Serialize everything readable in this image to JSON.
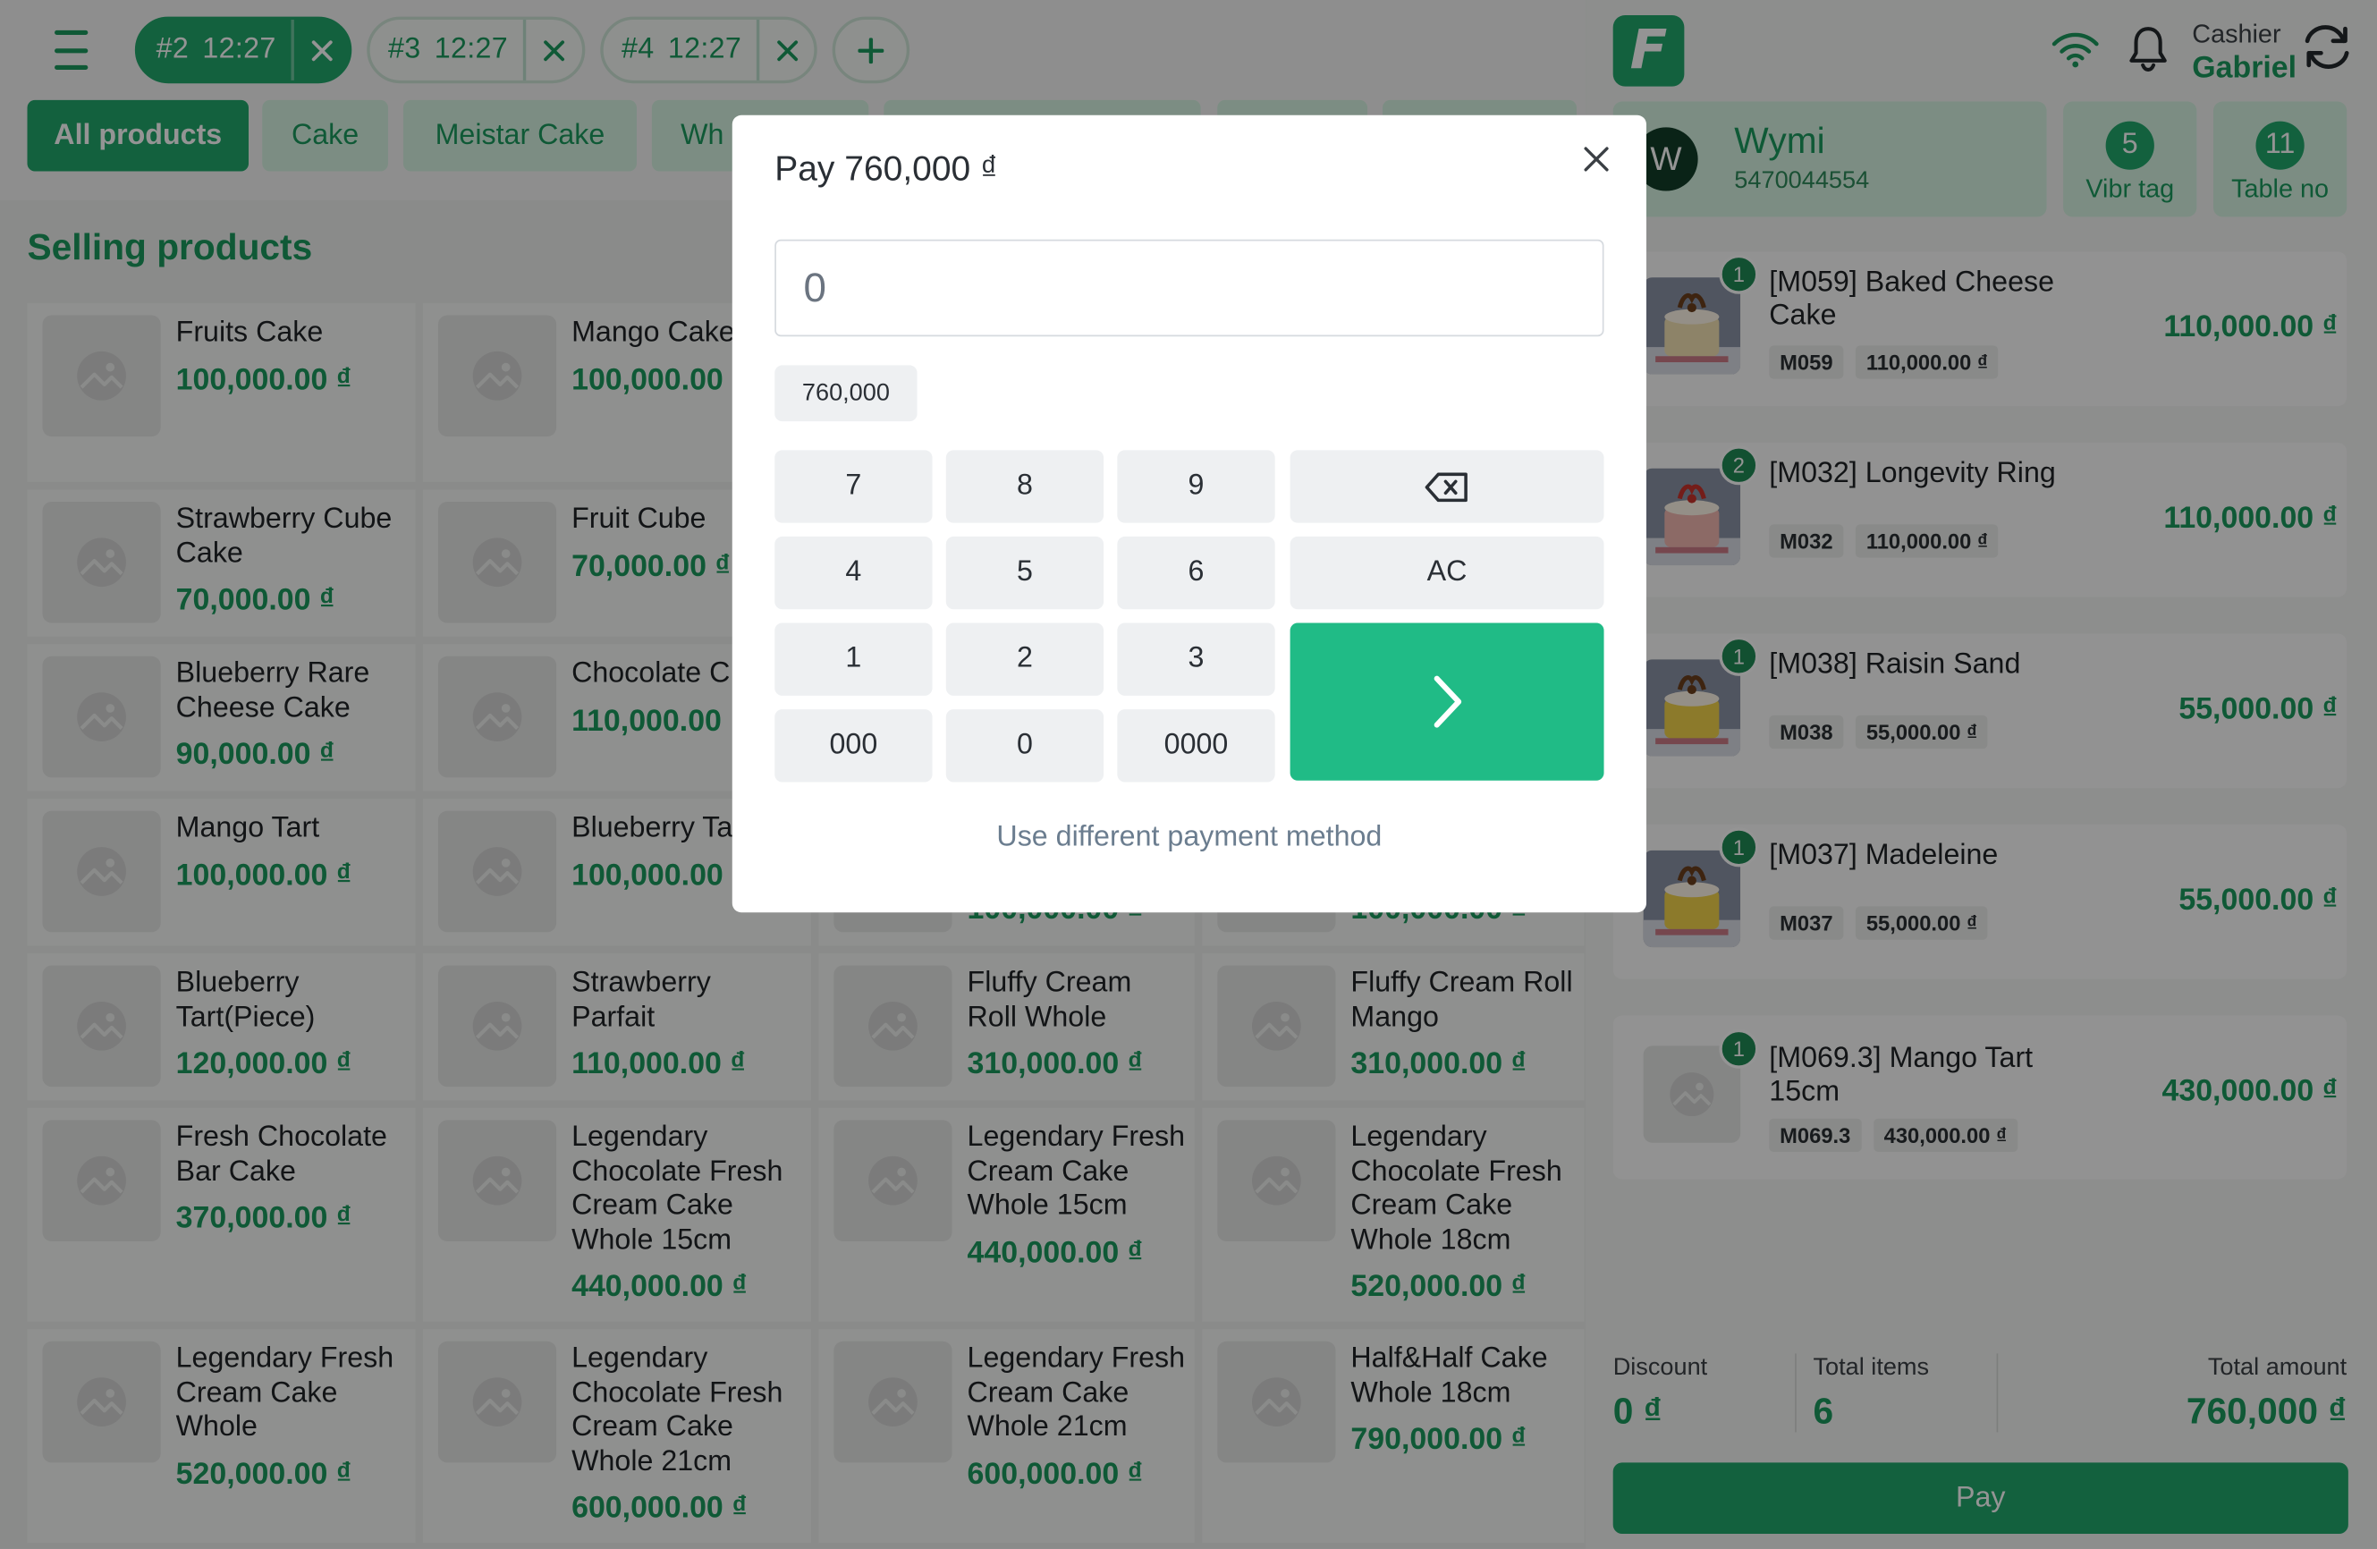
{
  "order_tabs": [
    {
      "number": "#2",
      "time": "12:27",
      "active": true
    },
    {
      "number": "#3",
      "time": "12:27",
      "active": false
    },
    {
      "number": "#4",
      "time": "12:27",
      "active": false
    }
  ],
  "categories": [
    {
      "label": "All products",
      "active": true
    },
    {
      "label": "Cake",
      "active": false
    },
    {
      "label": "Meistar Cake",
      "active": false
    },
    {
      "label": "Wh",
      "active": false
    },
    {
      "label": "",
      "active": false
    },
    {
      "label": "",
      "active": false
    },
    {
      "label": "",
      "active": false
    }
  ],
  "section_title": "Selling products",
  "products": [
    {
      "name": "Fruits Cake",
      "price": "100,000.00 ₫"
    },
    {
      "name": "Mango Cake",
      "price": "100,000.00"
    },
    {
      "name": "",
      "price": ""
    },
    {
      "name": "",
      "price": ""
    },
    {
      "name": "Strawberry Cube Cake",
      "price": "70,000.00 ₫"
    },
    {
      "name": "Fruit Cube",
      "price": "70,000.00 ₫"
    },
    {
      "name": "",
      "price": ""
    },
    {
      "name": "",
      "price": ""
    },
    {
      "name": "Blueberry Rare Cheese Cake",
      "price": "90,000.00 ₫"
    },
    {
      "name": "Chocolate C",
      "price": "110,000.00"
    },
    {
      "name": "",
      "price": ""
    },
    {
      "name": "",
      "price": ""
    },
    {
      "name": "Mango Tart",
      "price": "100,000.00 ₫"
    },
    {
      "name": "Blueberry Ta",
      "price": "100,000.00"
    },
    {
      "name": "",
      "price": "100,000.00 ₫"
    },
    {
      "name": "",
      "price": "100,000.00 ₫"
    },
    {
      "name": "Blueberry Tart(Piece)",
      "price": "120,000.00 ₫"
    },
    {
      "name": "Strawberry Parfait",
      "price": "110,000.00 ₫"
    },
    {
      "name": "Fluffy Cream Roll Whole",
      "price": "310,000.00 ₫"
    },
    {
      "name": "Fluffy Cream Roll Mango",
      "price": "310,000.00 ₫"
    },
    {
      "name": "Fresh Chocolate Bar Cake",
      "price": "370,000.00 ₫"
    },
    {
      "name": "Legendary Chocolate Fresh Cream Cake Whole 15cm",
      "price": "440,000.00 ₫"
    },
    {
      "name": "Legendary Fresh Cream Cake Whole 15cm",
      "price": "440,000.00 ₫"
    },
    {
      "name": "Legendary Chocolate Fresh Cream Cake Whole 18cm",
      "price": "520,000.00 ₫"
    },
    {
      "name": "Legendary Fresh Cream Cake Whole",
      "price": "520,000.00 ₫"
    },
    {
      "name": "Legendary Chocolate Fresh Cream Cake Whole 21cm",
      "price": "600,000.00 ₫"
    },
    {
      "name": "Legendary Fresh Cream Cake Whole 21cm",
      "price": "600,000.00 ₫"
    },
    {
      "name": "Half&Half Cake Whole 18cm",
      "price": "790,000.00 ₫"
    }
  ],
  "header": {
    "logo_letter": "F",
    "cashier_label": "Cashier",
    "cashier_name": "Gabriel"
  },
  "customer": {
    "initial": "W",
    "name": "Wymi",
    "phone": "5470044554"
  },
  "tags": [
    {
      "value": "5",
      "label": "Vibr tag"
    },
    {
      "value": "11",
      "label": "Table no"
    }
  ],
  "cart": [
    {
      "qty": "1",
      "name": "[M059] Baked Cheese Cake",
      "code": "M059",
      "unit_price": "110,000.00 ₫",
      "total": "110,000.00 ₫",
      "image": "cake-photo"
    },
    {
      "qty": "2",
      "name": "[M032] Longevity Ring",
      "code": "M032",
      "unit_price": "110,000.00 ₫",
      "total": "110,000.00 ₫",
      "image": "cake-photo-pink"
    },
    {
      "qty": "1",
      "name": "[M038] Raisin Sand",
      "code": "M038",
      "unit_price": "55,000.00 ₫",
      "total": "55,000.00 ₫",
      "image": "cake-photo-yellow"
    },
    {
      "qty": "1",
      "name": "[M037] Madeleine",
      "code": "M037",
      "unit_price": "55,000.00 ₫",
      "total": "55,000.00 ₫",
      "image": "cake-photo-yellow"
    },
    {
      "qty": "1",
      "name": "[M069.3] Mango Tart 15cm",
      "code": "M069.3",
      "unit_price": "430,000.00 ₫",
      "total": "430,000.00 ₫",
      "image": "placeholder"
    }
  ],
  "summary": {
    "discount_label": "Discount",
    "discount_value": "0 ₫",
    "items_label": "Total items",
    "items_value": "6",
    "amount_label": "Total amount",
    "amount_value": "760,000 ₫",
    "pay_label": "Pay"
  },
  "modal": {
    "title": "Pay 760,000 ₫",
    "input_value": "0",
    "quick_amount": "760,000",
    "keys": [
      "7",
      "8",
      "9",
      "4",
      "5",
      "6",
      "AC",
      "1",
      "2",
      "3",
      "000",
      "0",
      "0000"
    ],
    "alt_payment_label": "Use different payment method"
  },
  "colors": {
    "brand_green": "#22a86c",
    "price_green": "#1b9a5e",
    "submit_green": "#20bb86"
  }
}
